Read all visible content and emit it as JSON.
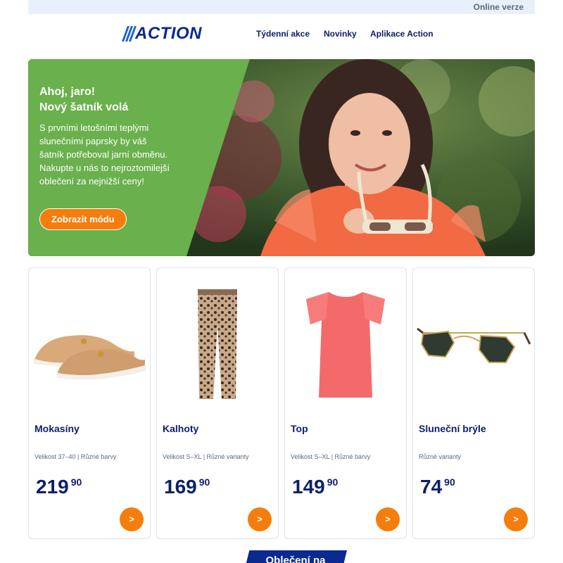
{
  "topbar": {
    "online_version": "Online verze"
  },
  "header": {
    "logo_text": "ACTION",
    "nav": [
      "Týdenní akce",
      "Novinky",
      "Aplikace Action"
    ]
  },
  "hero": {
    "title_line1": "Ahoj, jaro!",
    "title_line2": "Nový šatník volá",
    "text": "S prvními letošními teplými slunečními paprsky by váš šatník potřeboval jarní obměnu. Nakupte u nás to nejroztomilejší oblečení za nejnižší ceny!",
    "button": "Zobrazit módu",
    "accent_green": "#6ab04c",
    "button_color": "#f57d0d"
  },
  "products": [
    {
      "name": "Mokasíny",
      "details": "Velikost 37–40 | Různé barvy",
      "price_int": "219",
      "price_dec": "90",
      "arrow": ">",
      "icon": "loafers-image"
    },
    {
      "name": "Kalhoty",
      "details": "Velikost S–XL | Různé varianty",
      "price_int": "169",
      "price_dec": "90",
      "arrow": ">",
      "icon": "trousers-image"
    },
    {
      "name": "Top",
      "details": "Velikost S–XL | Různé barvy",
      "price_int": "149",
      "price_dec": "90",
      "arrow": ">",
      "icon": "top-image"
    },
    {
      "name": "Sluneční brýle",
      "details": "Různé varianty",
      "price_int": "74",
      "price_dec": "90",
      "arrow": ">",
      "icon": "sunglasses-image"
    }
  ],
  "bottom": {
    "banner_text": "Oblečení na"
  },
  "colors": {
    "brand_blue": "#0a2a8f",
    "accent_orange": "#f57d0d"
  }
}
